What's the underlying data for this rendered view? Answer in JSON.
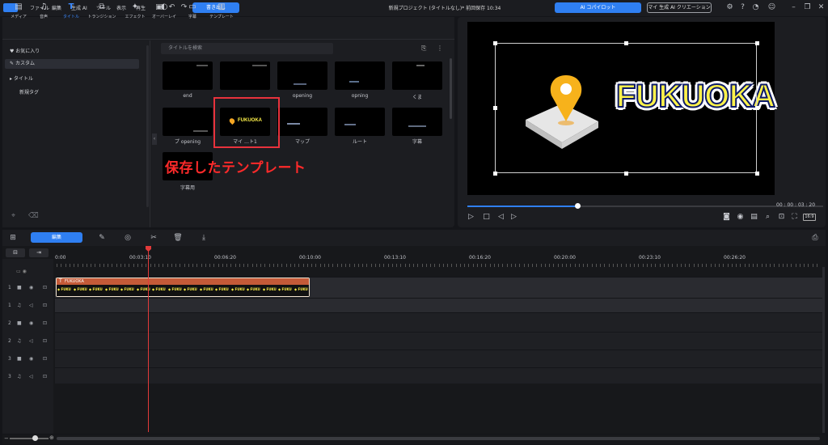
{
  "titlebar": {
    "menu": [
      "ファイル",
      "編集",
      "生成 AI",
      "ツール",
      "表示",
      "再生"
    ],
    "export_label": "書き出し",
    "project_title": "新規プロジェクト (タイトルなし)* 前回保存 10:34",
    "copilot_label": "AI コパイロット",
    "creation_label": "マイ 生成 AI クリエーション"
  },
  "tabs": [
    "メディア",
    "音声",
    "タイトル",
    "トランジション",
    "エフェクト",
    "オーバーレイ",
    "字幕",
    "テンプレート"
  ],
  "active_tab": "タイトル",
  "sidebar": {
    "items": [
      "お気に入り",
      "カスタム",
      "タイトル",
      "新規タグ"
    ]
  },
  "search": {
    "placeholder": "タイトルを検索"
  },
  "templates": [
    {
      "label": "end"
    },
    {
      "label": ""
    },
    {
      "label": "opening"
    },
    {
      "label": "opning"
    },
    {
      "label": "くま"
    },
    {
      "label": "プ opening"
    },
    {
      "label": "マイ …ト1"
    },
    {
      "label": "マップ"
    },
    {
      "label": "ルート"
    },
    {
      "label": "字幕"
    },
    {
      "label": "字幕用"
    }
  ],
  "annotation": "保存したテンプレート",
  "preview": {
    "title_text": "FUKUOKA",
    "timecode": "00 : 00 : 03 : 20",
    "progress": 0.31,
    "ratio": "16:9"
  },
  "timeline": {
    "edit_label": "編集",
    "ruler": [
      "0:00",
      "00:03:10",
      "00:06:20",
      "00:10:00",
      "00:13:10",
      "00:16:20",
      "00:20:00",
      "00:23:10",
      "00:26:20"
    ],
    "clip_label": "FUKUOKA",
    "tracks": [
      "1",
      "1",
      "2",
      "2",
      "3",
      "3"
    ]
  },
  "colors": {
    "accent": "#2f7ff2",
    "annotation": "#ff2a2a",
    "clip": "#c45a38"
  }
}
